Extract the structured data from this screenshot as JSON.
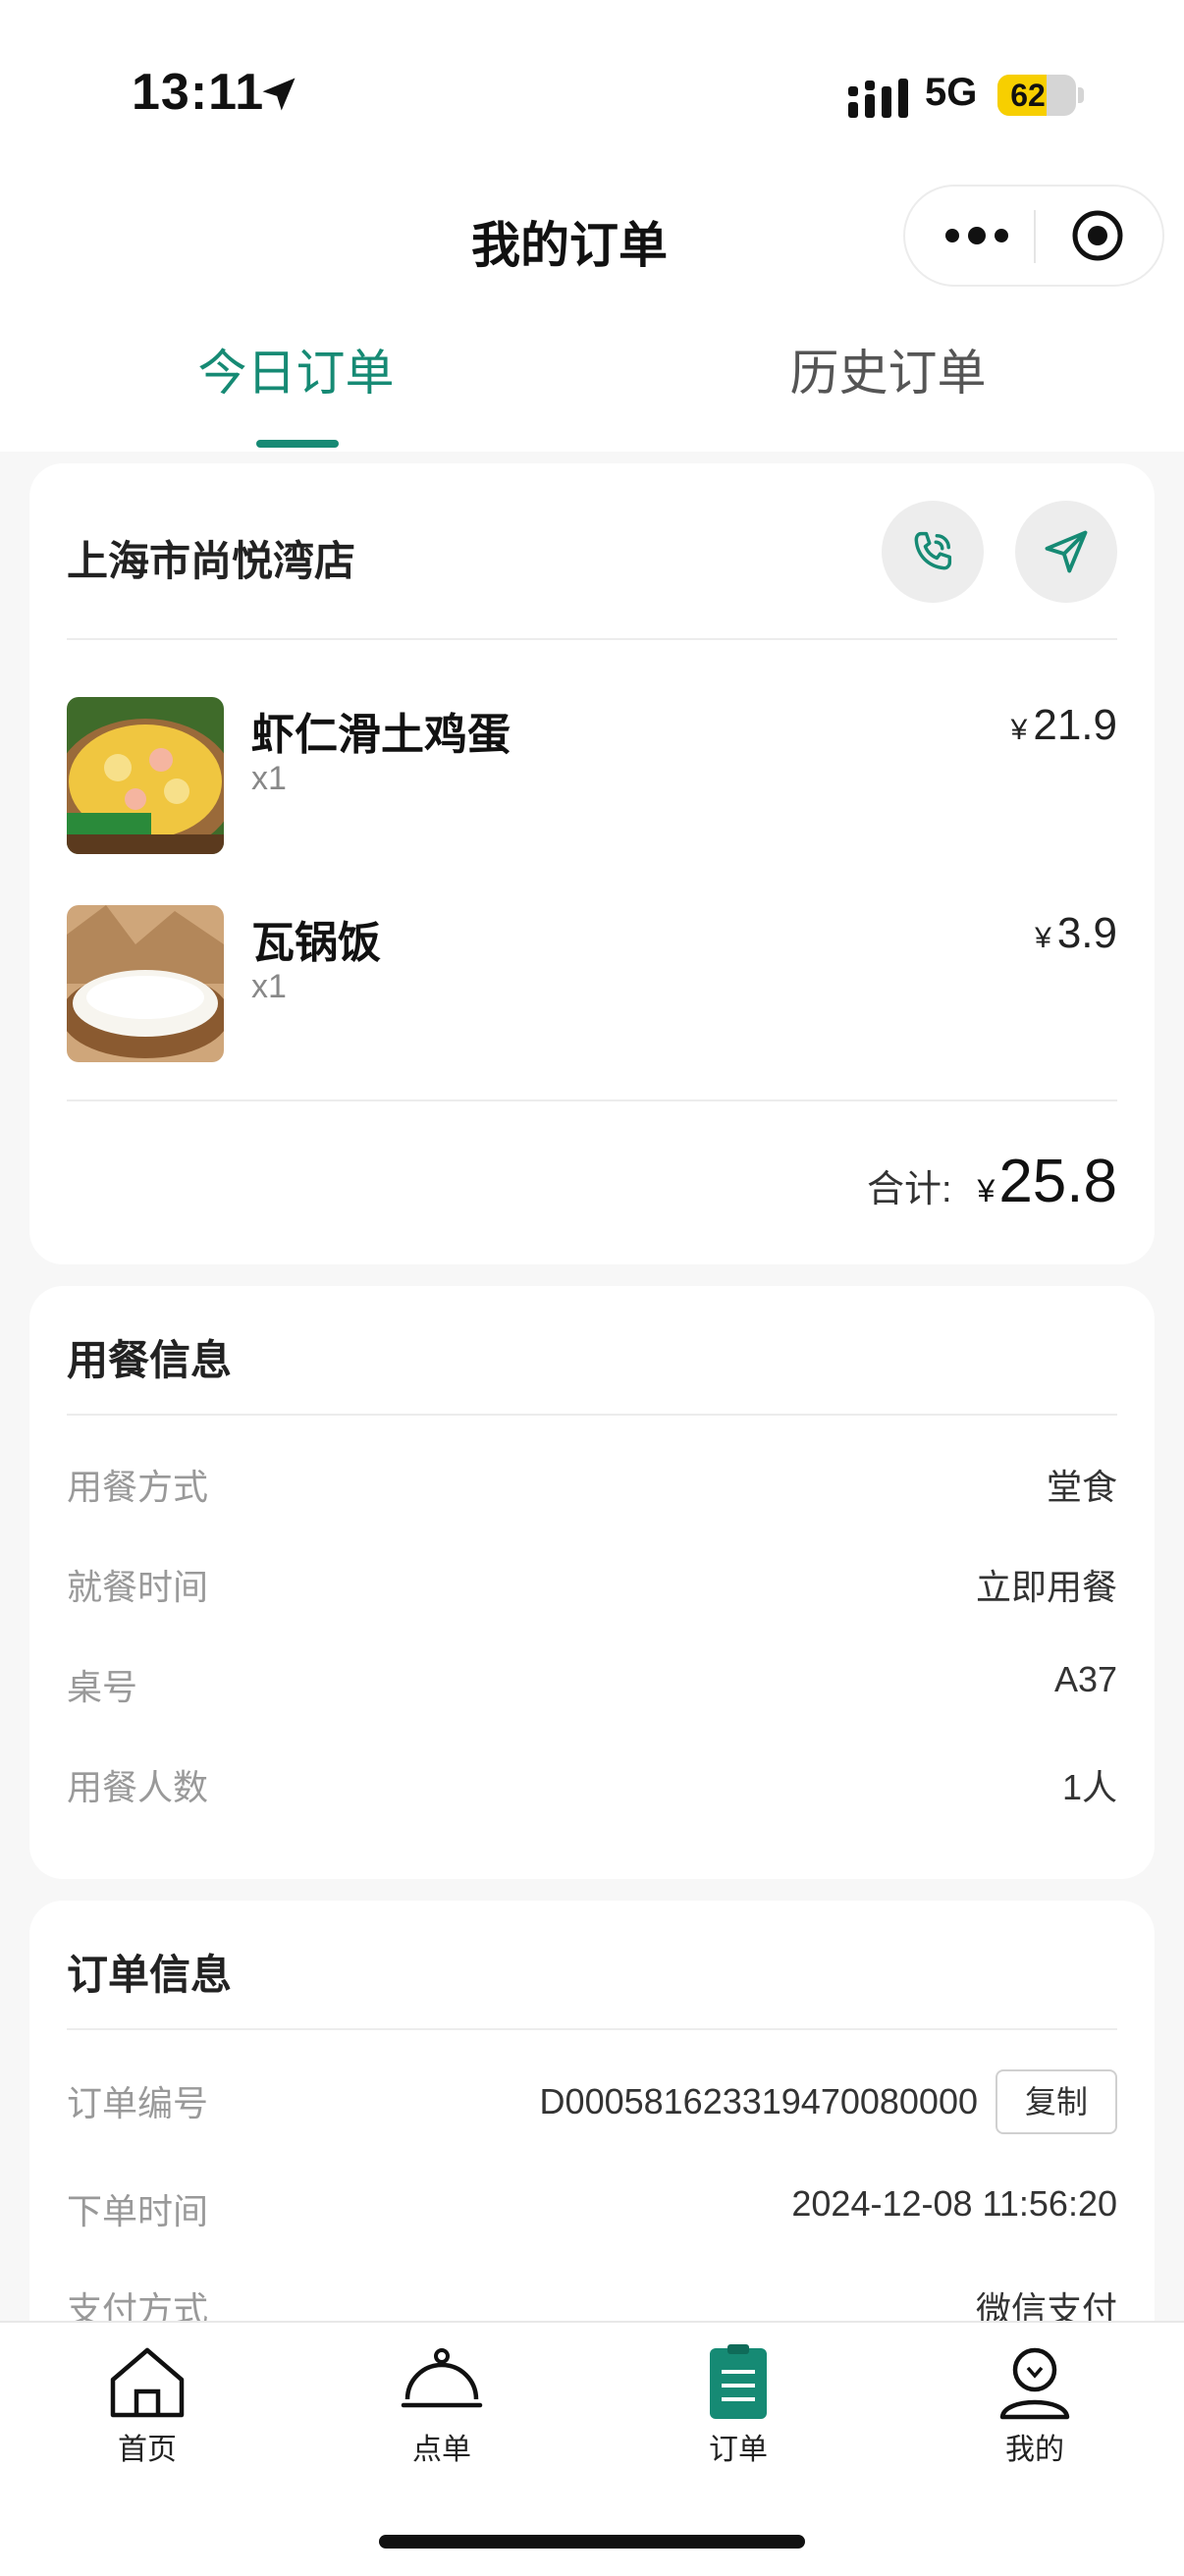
{
  "status_bar": {
    "time": "13:11",
    "network": "5G",
    "battery": "62",
    "battery_level": 0.62
  },
  "header": {
    "title": "我的订单",
    "tabs": [
      {
        "label": "今日订单",
        "active": true
      },
      {
        "label": "历史订单",
        "active": false
      }
    ]
  },
  "order": {
    "store_name": "上海市尚悦湾店",
    "items": [
      {
        "name": "虾仁滑土鸡蛋",
        "qty": "x1",
        "currency": "¥",
        "price": "21.9"
      },
      {
        "name": "瓦锅饭",
        "qty": "x1",
        "currency": "¥",
        "price": "3.9"
      }
    ],
    "total_label": "合计:",
    "total_currency": "¥",
    "total_amount": "25.8"
  },
  "dining_info": {
    "title": "用餐信息",
    "rows": [
      {
        "label": "用餐方式",
        "value": "堂食"
      },
      {
        "label": "就餐时间",
        "value": "立即用餐"
      },
      {
        "label": "桌号",
        "value": "A37"
      },
      {
        "label": "用餐人数",
        "value": "1人"
      }
    ]
  },
  "order_info": {
    "title": "订单信息",
    "rows": [
      {
        "label": "订单编号",
        "value": "D000581623319470080000"
      },
      {
        "label": "下单时间",
        "value": "2024-12-08 11:56:20"
      },
      {
        "label": "支付方式",
        "value": "微信支付"
      }
    ],
    "copy_label": "复制"
  },
  "tab_bar": {
    "items": [
      {
        "label": "首页",
        "icon": "home-icon"
      },
      {
        "label": "点单",
        "icon": "cloche-icon"
      },
      {
        "label": "订单",
        "icon": "clipboard-icon",
        "active": true
      },
      {
        "label": "我的",
        "icon": "profile-icon"
      }
    ]
  },
  "colors": {
    "accent": "#168a74",
    "background": "#f7f7f7",
    "card": "#ffffff",
    "battery": "#f7cf00"
  }
}
